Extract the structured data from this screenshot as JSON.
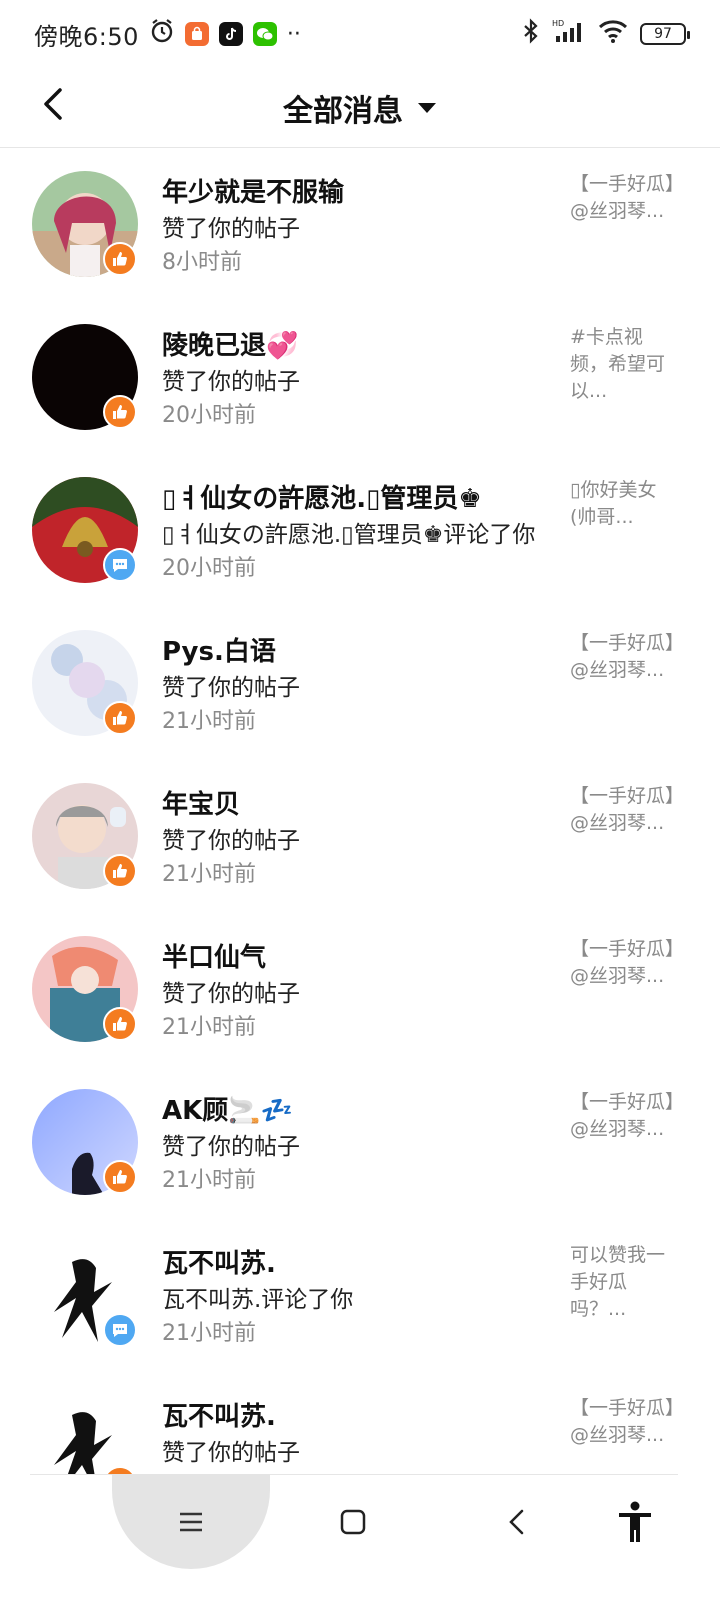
{
  "status_bar": {
    "time": "傍晚6:50",
    "battery": "97"
  },
  "header": {
    "title": "全部消息"
  },
  "colors": {
    "like_badge": "#f47c20",
    "comment_badge": "#4fa8f2",
    "muted_text": "#8a8a8a"
  },
  "messages": [
    {
      "name": "年少就是不服输",
      "action": "赞了你的帖子",
      "time": "8小时前",
      "preview": "【一手好瓜】@丝羽琴...",
      "badge": "like-icon"
    },
    {
      "name": "陵晚已退💞",
      "action": "赞了你的帖子",
      "time": "20小时前",
      "preview": "#卡点视频，希望可以...",
      "badge": "like-icon"
    },
    {
      "name": "▯ㅕ仙女の許愿池.▯管理员♚",
      "action": "▯ㅕ仙女の許愿池.▯管理员♚评论了你",
      "time": "20小时前",
      "preview": "▯你好美女(帅哥...",
      "badge": "comment-icon"
    },
    {
      "name": "Pys.白语",
      "action": "赞了你的帖子",
      "time": "21小时前",
      "preview": "【一手好瓜】@丝羽琴...",
      "badge": "like-icon"
    },
    {
      "name": "年宝贝",
      "action": "赞了你的帖子",
      "time": "21小时前",
      "preview": "【一手好瓜】@丝羽琴...",
      "badge": "like-icon"
    },
    {
      "name": "半口仙气",
      "action": "赞了你的帖子",
      "time": "21小时前",
      "preview": "【一手好瓜】@丝羽琴...",
      "badge": "like-icon"
    },
    {
      "name": "AK顾🚬💤",
      "action": "赞了你的帖子",
      "time": "21小时前",
      "preview": "【一手好瓜】@丝羽琴...",
      "badge": "like-icon"
    },
    {
      "name": "瓦不叫苏.",
      "action": "瓦不叫苏.评论了你",
      "time": "21小时前",
      "preview": "可以赞我一手好瓜吗？...",
      "badge": "comment-icon"
    },
    {
      "name": "瓦不叫苏.",
      "action": "赞了你的帖子",
      "time": "",
      "preview": "【一手好瓜】@丝羽琴...",
      "badge": "like-icon"
    }
  ]
}
